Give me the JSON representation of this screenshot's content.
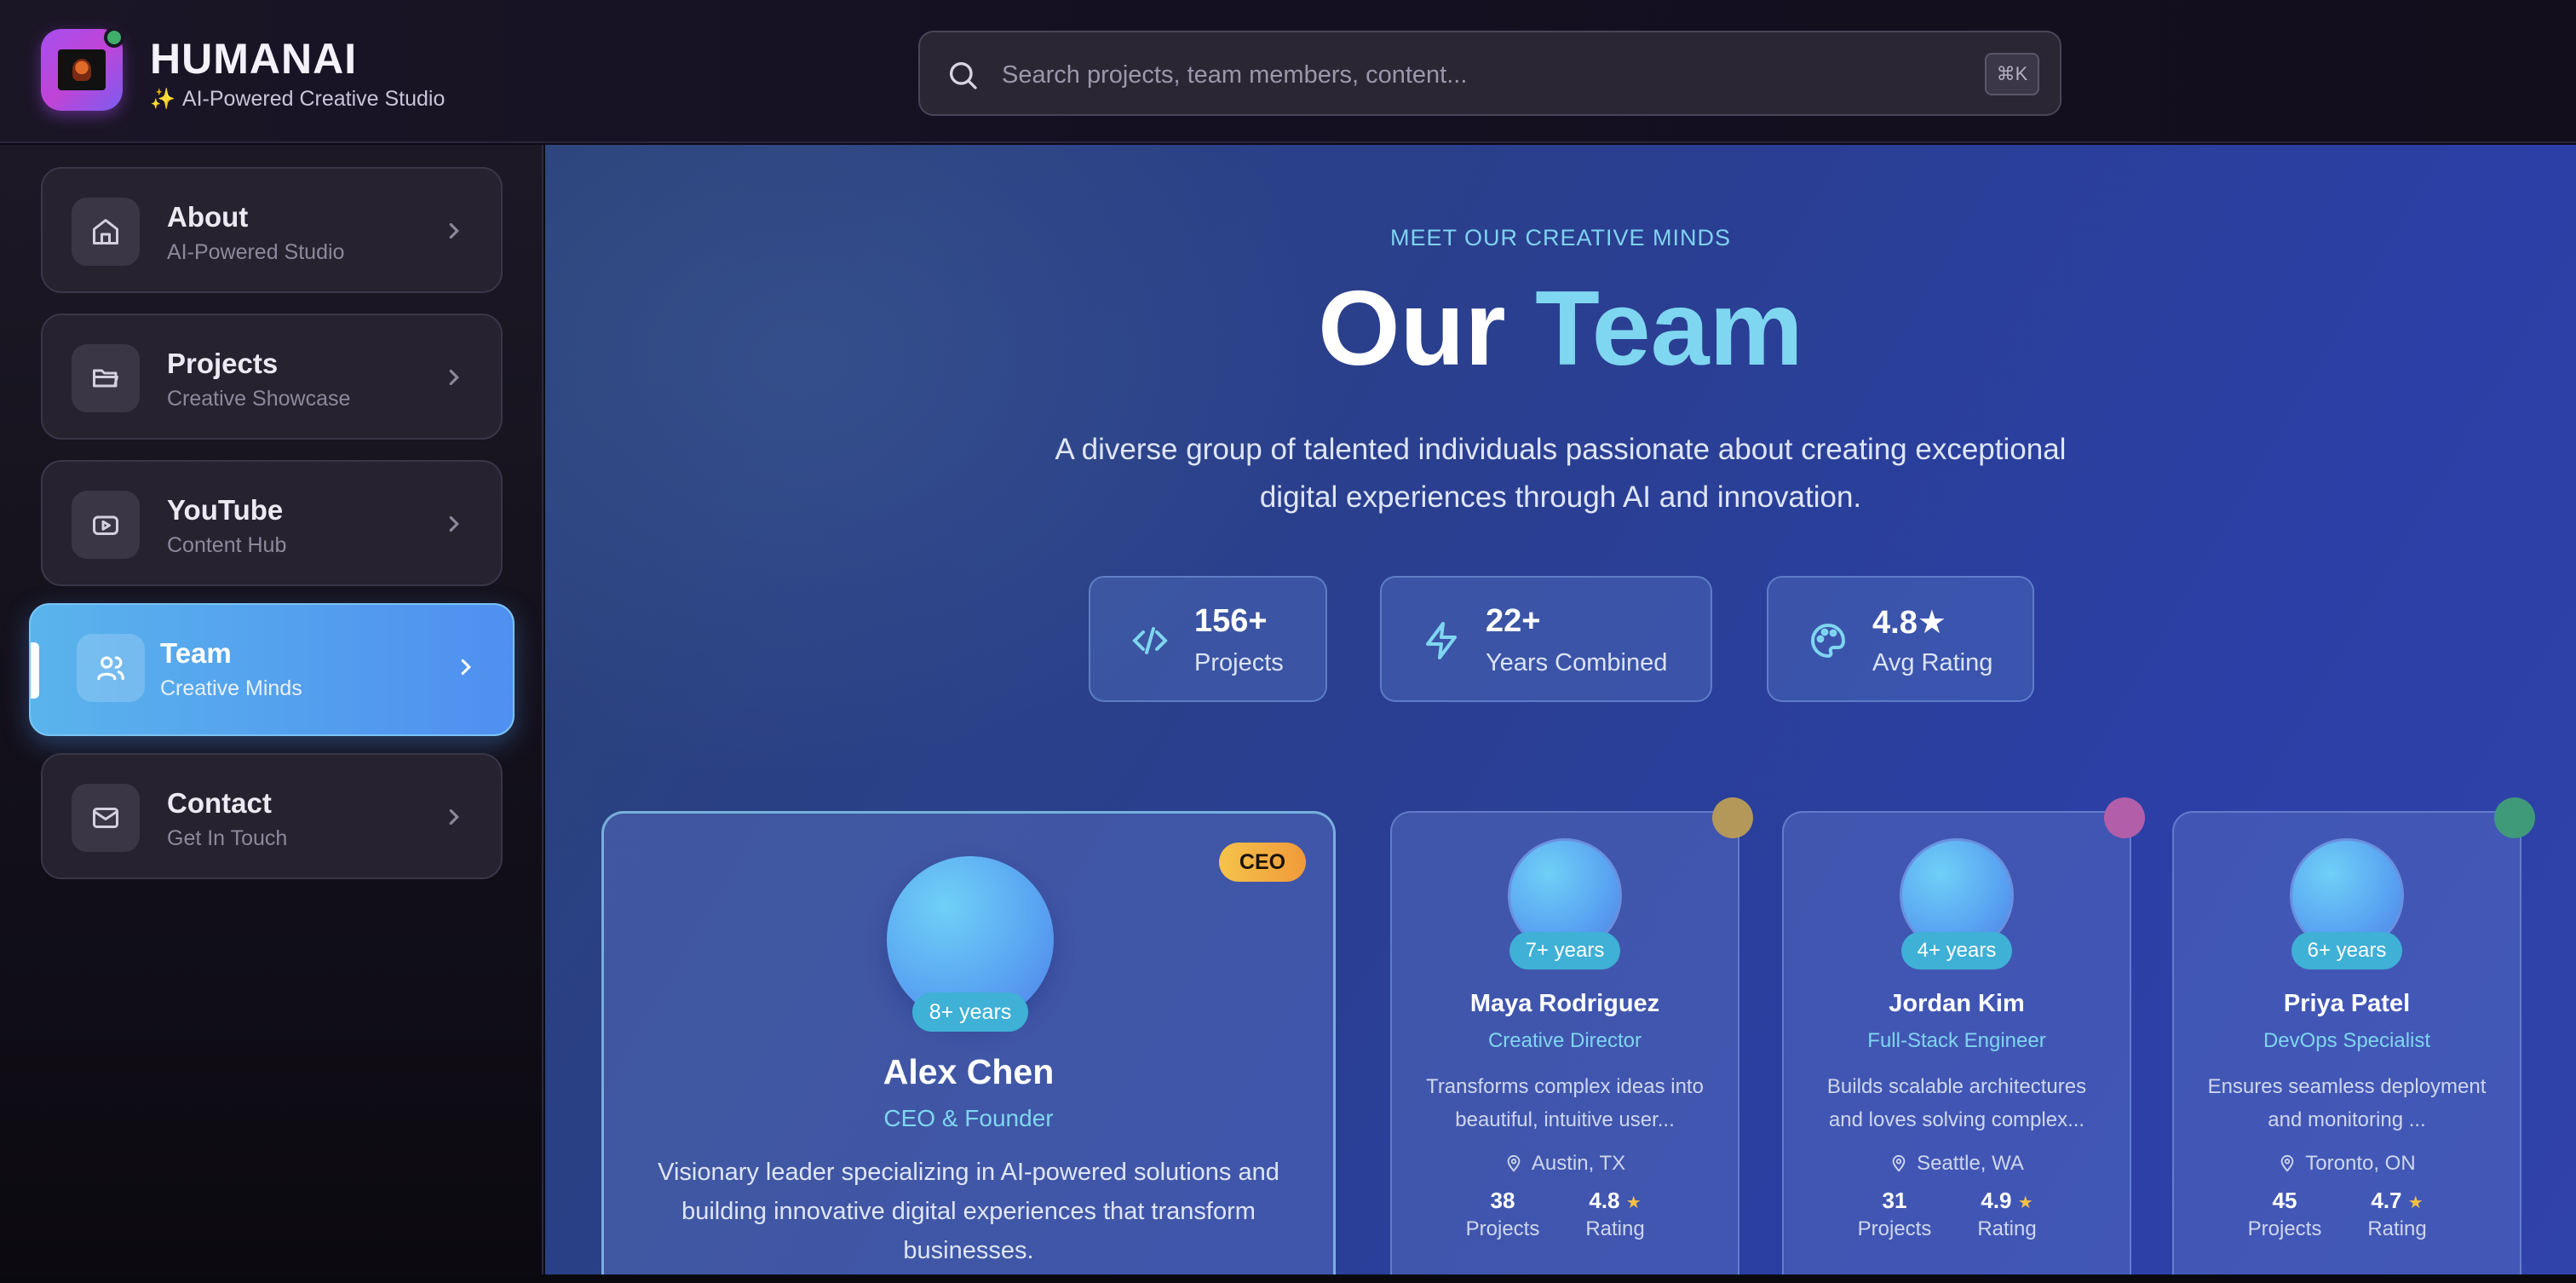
{
  "brand": {
    "title": "HUMANAI",
    "subtitle": "AI-Powered Creative Studio"
  },
  "search": {
    "placeholder": "Search projects, team members, content...",
    "shortcut": "⌘K"
  },
  "sidebar": {
    "items": [
      {
        "label": "About",
        "sub": "AI-Powered Studio",
        "icon": "home-icon"
      },
      {
        "label": "Projects",
        "sub": "Creative Showcase",
        "icon": "folder-icon"
      },
      {
        "label": "YouTube",
        "sub": "Content Hub",
        "icon": "youtube-icon"
      },
      {
        "label": "Team",
        "sub": "Creative Minds",
        "icon": "users-icon",
        "active": true
      },
      {
        "label": "Contact",
        "sub": "Get In Touch",
        "icon": "mail-icon"
      }
    ]
  },
  "hero": {
    "eyebrow": "MEET OUR CREATIVE MINDS",
    "title_part1": "Our",
    "title_part2": "Team",
    "lede": "A diverse group of talented individuals passionate about creating exceptional digital experiences through AI and innovation."
  },
  "stats": [
    {
      "value": "156+",
      "label": "Projects",
      "icon": "code-icon"
    },
    {
      "value": "22+",
      "label": "Years Combined",
      "icon": "lightning-icon"
    },
    {
      "value": "4.8★",
      "label": "Avg Rating",
      "icon": "palette-icon"
    }
  ],
  "featured": {
    "badge": "CEO",
    "years": "8+ years",
    "name": "Alex Chen",
    "role": "CEO & Founder",
    "bio": "Visionary leader specializing in AI-powered solutions and building innovative digital experiences that transform businesses."
  },
  "members": [
    {
      "name": "Maya Rodriguez",
      "role": "Creative Director",
      "years": "7+ years",
      "bio": "Transforms complex ideas into beautiful, intuitive user...",
      "location": "Austin, TX",
      "projects": "38",
      "projects_label": "Projects",
      "rating": "4.8",
      "rating_label": "Rating",
      "dot_color": "#b4985a"
    },
    {
      "name": "Jordan Kim",
      "role": "Full-Stack Engineer",
      "years": "4+ years",
      "bio": "Builds scalable architectures and loves solving complex...",
      "location": "Seattle, WA",
      "projects": "31",
      "projects_label": "Projects",
      "rating": "4.9",
      "rating_label": "Rating",
      "dot_color": "#b25ea8"
    },
    {
      "name": "Priya Patel",
      "role": "DevOps Specialist",
      "years": "6+ years",
      "bio": "Ensures seamless deployment and monitoring ...",
      "location": "Toronto, ON",
      "projects": "45",
      "projects_label": "Projects",
      "rating": "4.7",
      "rating_label": "Rating",
      "dot_color": "#3f9a7a"
    }
  ],
  "colors": {
    "accent": "#7fd6f0",
    "active_nav": "#5ab4ec",
    "badge": "#f5c34a",
    "star": "#f5c042"
  }
}
